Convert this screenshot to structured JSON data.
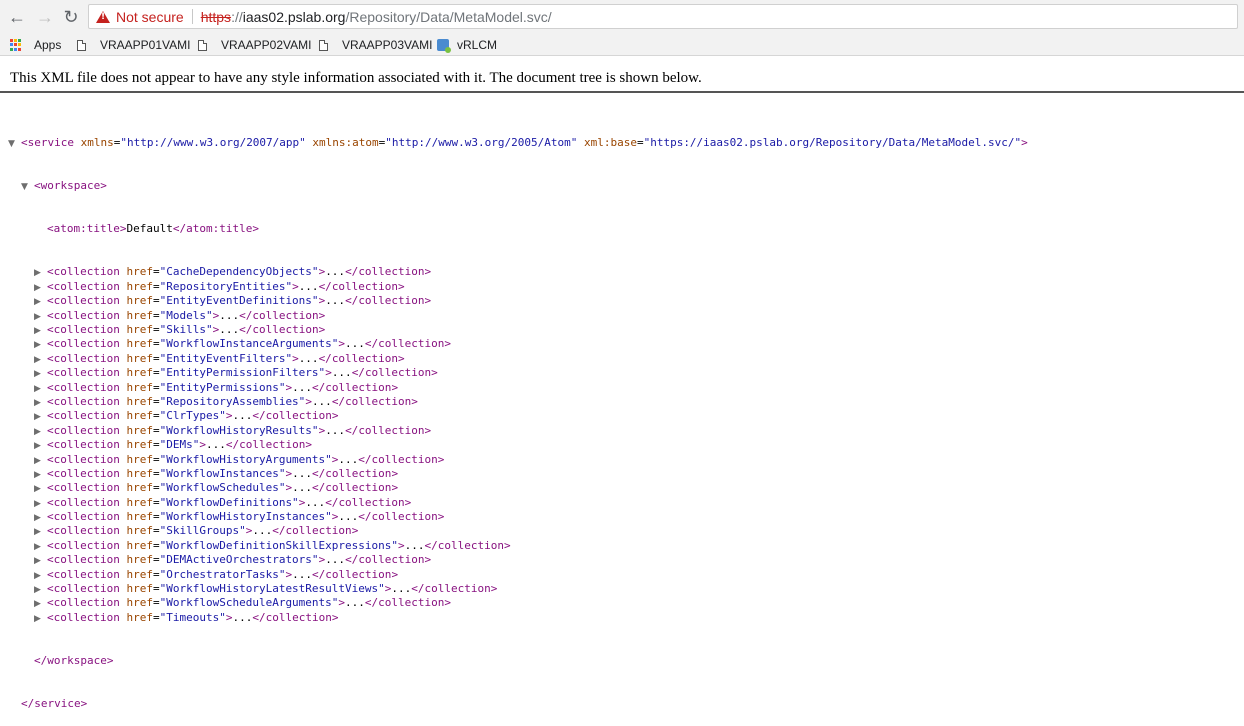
{
  "browser": {
    "security_text": "Not secure",
    "url_scheme": "https",
    "url_rest_prefix": "://",
    "url_host": "iaas02.pslab.org",
    "url_path": "/Repository/Data/MetaModel.svc/",
    "bookmarks": [
      "Apps",
      "VRAAPP01VAMI",
      "VRAAPP02VAMI",
      "VRAAPP03VAMI",
      "vRLCM"
    ]
  },
  "notice": "This XML file does not appear to have any style information associated with it. The document tree is shown below.",
  "xml": {
    "service_open": {
      "tag": "service",
      "attrs": [
        {
          "name": "xmlns",
          "value": "\"http://www.w3.org/2007/app\""
        },
        {
          "name": "xmlns:atom",
          "value": "\"http://www.w3.org/2005/Atom\""
        },
        {
          "name": "xml:base",
          "value": "\"https://iaas02.pslab.org/Repository/Data/MetaModel.svc/\""
        }
      ]
    },
    "workspace_tag": "workspace",
    "title_tag": "atom:title",
    "title_text": "Default",
    "collection_tag": "collection",
    "collection_attr": "href",
    "ellipsis": "...",
    "collections": [
      "\"CacheDependencyObjects\"",
      "\"RepositoryEntities\"",
      "\"EntityEventDefinitions\"",
      "\"Models\"",
      "\"Skills\"",
      "\"WorkflowInstanceArguments\"",
      "\"EntityEventFilters\"",
      "\"EntityPermissionFilters\"",
      "\"EntityPermissions\"",
      "\"RepositoryAssemblies\"",
      "\"ClrTypes\"",
      "\"WorkflowHistoryResults\"",
      "\"DEMs\"",
      "\"WorkflowHistoryArguments\"",
      "\"WorkflowInstances\"",
      "\"WorkflowSchedules\"",
      "\"WorkflowDefinitions\"",
      "\"WorkflowHistoryInstances\"",
      "\"SkillGroups\"",
      "\"WorkflowDefinitionSkillExpressions\"",
      "\"DEMActiveOrchestrators\"",
      "\"OrchestratorTasks\"",
      "\"WorkflowHistoryLatestResultViews\"",
      "\"WorkflowScheduleArguments\"",
      "\"Timeouts\""
    ]
  }
}
